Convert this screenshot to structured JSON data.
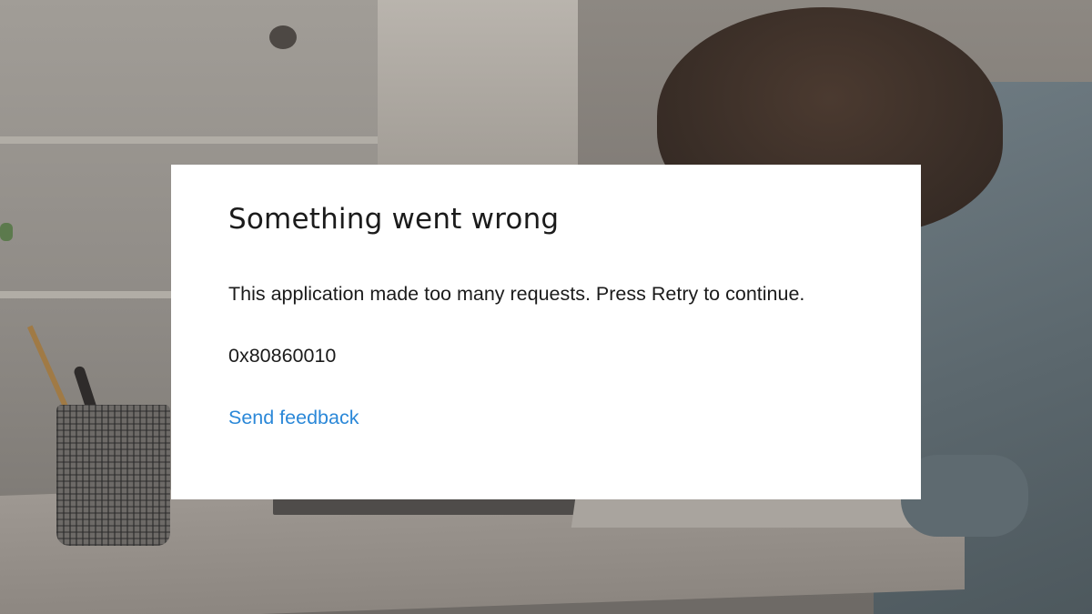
{
  "dialog": {
    "title": "Something went wrong",
    "message": "This application made too many requests. Press Retry to continue.",
    "error_code": "0x80860010",
    "feedback_link_label": "Send feedback"
  },
  "colors": {
    "dialog_background": "#ffffff",
    "text": "#1b1b1b",
    "link": "#2b88d8"
  }
}
